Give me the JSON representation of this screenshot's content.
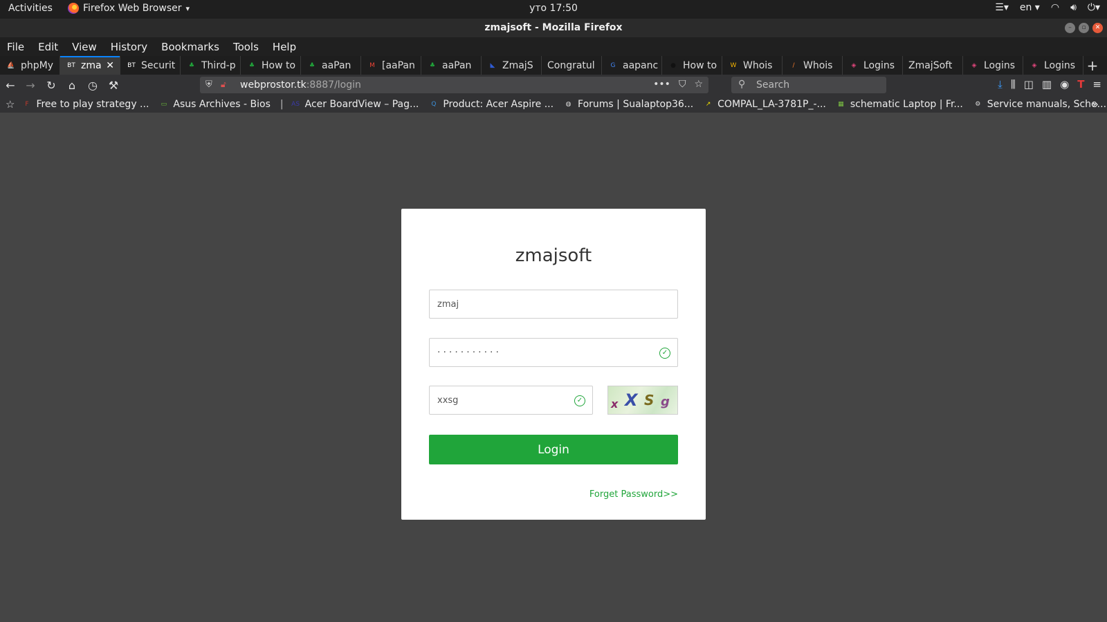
{
  "system_bar": {
    "activities": "Activities",
    "app_name": "Firefox Web Browser",
    "app_menu_arrow": "▾",
    "clock": "уто 17:50",
    "keyboard_layout": "en",
    "icons": [
      "menu-icon",
      "wifi-icon",
      "volume-icon",
      "power-icon"
    ]
  },
  "window": {
    "title": "zmajsoft - Mozilla Firefox"
  },
  "menubar": {
    "items": [
      "File",
      "Edit",
      "View",
      "History",
      "Bookmarks",
      "Tools",
      "Help"
    ]
  },
  "tabs": [
    {
      "label": "phpMy",
      "icon": "phpmyadmin-icon",
      "icon_text": "⛵",
      "icon_color": "#f89c1c",
      "active": false
    },
    {
      "label": "zma",
      "icon": "bt-icon",
      "icon_text": "BT",
      "icon_color": "#ffffff",
      "active": true
    },
    {
      "label": "Securit",
      "icon": "bt-icon",
      "icon_text": "BT",
      "icon_color": "#ffffff",
      "active": false
    },
    {
      "label": "Third-p",
      "icon": "aapanel-icon",
      "icon_text": "♣",
      "icon_color": "#20a53a",
      "active": false
    },
    {
      "label": "How to",
      "icon": "aapanel-icon",
      "icon_text": "♣",
      "icon_color": "#20a53a",
      "active": false
    },
    {
      "label": "aaPan",
      "icon": "aapanel-icon",
      "icon_text": "♣",
      "icon_color": "#20a53a",
      "active": false
    },
    {
      "label": "[aaPan",
      "icon": "gmail-icon",
      "icon_text": "M",
      "icon_color": "#ea4335",
      "active": false
    },
    {
      "label": "aaPan",
      "icon": "aapanel-icon",
      "icon_text": "♣",
      "icon_color": "#20a53a",
      "active": false
    },
    {
      "label": "ZmajS",
      "icon": "zmajsoft-icon",
      "icon_text": "◣",
      "icon_color": "#2f5bd3",
      "active": false
    },
    {
      "label": "Congratul",
      "icon": "",
      "icon_text": "",
      "icon_color": "#ffffff",
      "active": false
    },
    {
      "label": "aapanc",
      "icon": "google-icon",
      "icon_text": "G",
      "icon_color": "#4285f4",
      "active": false
    },
    {
      "label": "How to",
      "icon": "dark-circle-icon",
      "icon_text": "●",
      "icon_color": "#111111",
      "active": false
    },
    {
      "label": "Whois",
      "icon": "whois-icon",
      "icon_text": "W",
      "icon_color": "#f5b400",
      "active": false
    },
    {
      "label": "Whois",
      "icon": "whois2-icon",
      "icon_text": "/",
      "icon_color": "#f07a2b",
      "active": false
    },
    {
      "label": "Logins",
      "icon": "logins-icon",
      "icon_text": "◈",
      "icon_color": "#e0457b",
      "active": false
    },
    {
      "label": "ZmajSoft",
      "icon": "",
      "icon_text": "",
      "icon_color": "#ffffff",
      "active": false
    },
    {
      "label": "Logins",
      "icon": "logins-icon",
      "icon_text": "◈",
      "icon_color": "#e0457b",
      "active": false
    },
    {
      "label": "Logins",
      "icon": "logins-icon",
      "icon_text": "◈",
      "icon_color": "#e0457b",
      "active": false
    }
  ],
  "navbar": {
    "url_host": "webprostor.tk",
    "url_rest": ":8887/login",
    "search_placeholder": "Search"
  },
  "bookmarks": [
    {
      "label": "Free to play strategy ...",
      "icon": "game-icon",
      "icon_text": "F",
      "icon_color": "#c0392b"
    },
    {
      "label": "Asus Archives - Bios",
      "icon": "asus-icon",
      "icon_text": "▭",
      "icon_color": "#6bbf3a"
    },
    {
      "label": "Acer BoardView – Pag...",
      "icon": "acer-icon",
      "icon_text": "AS",
      "icon_color": "#3a3aa8"
    },
    {
      "label": "Product: Acer Aspire ...",
      "icon": "acer-support-icon",
      "icon_text": "Q",
      "icon_color": "#3c8fd8"
    },
    {
      "label": "Forums | Sualaptop36...",
      "icon": "globe-icon",
      "icon_text": "◍",
      "icon_color": "#dddddd"
    },
    {
      "label": "COMPAL_LA-3781P_-...",
      "icon": "compal-icon",
      "icon_text": "↗",
      "icon_color": "#f1e100"
    },
    {
      "label": "schematic Laptop | Fr...",
      "icon": "schematic-icon",
      "icon_text": "▦",
      "icon_color": "#7bc043"
    },
    {
      "label": "Service manuals, Sche...",
      "icon": "service-icon",
      "icon_text": "⚙",
      "icon_color": "#dddddd"
    }
  ],
  "login": {
    "title": "zmajsoft",
    "username_value": "zmaj",
    "password_value": "···········",
    "captcha_value": "xxsg",
    "captcha_image_chars": [
      "x",
      "X",
      "S",
      "g"
    ],
    "login_button": "Login",
    "forget_link": "Forget Password>>"
  },
  "colors": {
    "brand_green": "#20a53a",
    "page_background": "#454545"
  }
}
